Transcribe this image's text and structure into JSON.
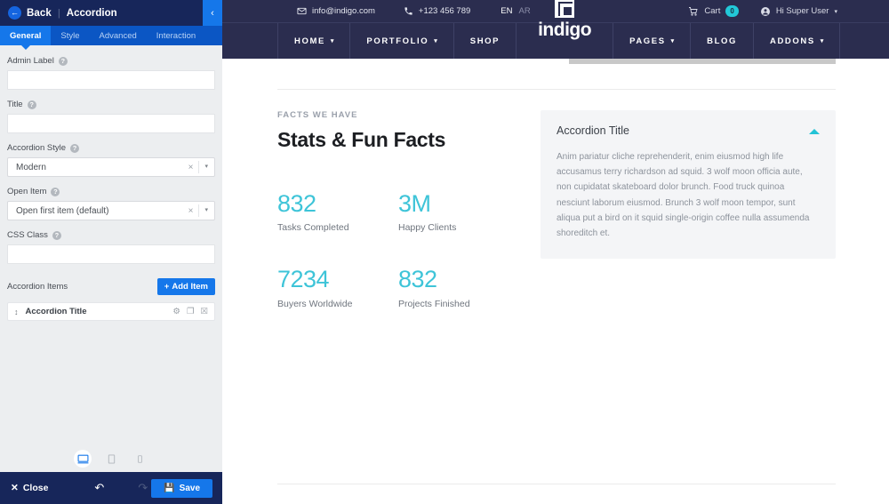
{
  "builder": {
    "header": {
      "back_icon": "arrow-left-icon",
      "back_label": "Back",
      "separator": "|",
      "title": "Accordion",
      "collapse_icon": "chevron-left-icon"
    },
    "tabs": [
      {
        "label": "General",
        "active": true
      },
      {
        "label": "Style",
        "active": false
      },
      {
        "label": "Advanced",
        "active": false
      },
      {
        "label": "Interaction",
        "active": false
      }
    ],
    "fields": {
      "admin_label": {
        "label": "Admin Label",
        "value": "",
        "placeholder": "",
        "help": "?"
      },
      "title": {
        "label": "Title",
        "value": "",
        "placeholder": "",
        "help": "?"
      },
      "accordion_style": {
        "label": "Accordion Style",
        "value": "Modern",
        "help": "?",
        "clear": "×",
        "arrow": "▾",
        "options": [
          "Modern"
        ]
      },
      "open_item": {
        "label": "Open Item",
        "value": "Open first item (default)",
        "help": "?",
        "clear": "×",
        "arrow": "▾",
        "options": [
          "Open first item (default)"
        ]
      },
      "css_class": {
        "label": "CSS Class",
        "value": "",
        "placeholder": "",
        "help": "?"
      }
    },
    "items_section": {
      "title": "Accordion Items",
      "add_label": "Add Item",
      "add_icon": "plus-icon",
      "items": [
        {
          "name": "Accordion Title",
          "drag_icon": "drag-handle-icon",
          "settings_icon": "gear-icon",
          "duplicate_icon": "copy-icon",
          "delete_icon": "trash-icon"
        }
      ]
    },
    "devices": [
      {
        "name": "desktop",
        "icon": "desktop-icon",
        "active": true
      },
      {
        "name": "tablet",
        "icon": "tablet-icon",
        "active": false
      },
      {
        "name": "mobile",
        "icon": "mobile-icon",
        "active": false
      }
    ],
    "footer": {
      "close_label": "Close",
      "close_icon": "close-icon",
      "undo_icon": "undo-icon",
      "redo_icon": "redo-icon",
      "save_label": "Save",
      "save_icon": "floppy-icon"
    },
    "colors": {
      "header_bg": "#17265a",
      "tab_bar": "#0b56c4",
      "accent": "#1577ea",
      "panel_bg": "#eceef0"
    }
  },
  "site": {
    "topbar": {
      "email_icon": "envelope-icon",
      "email": "info@indigo.com",
      "phone_icon": "phone-icon",
      "phone": "+123 456 789",
      "lang_active": "EN",
      "lang_inactive": "AR",
      "cart_icon": "cart-icon",
      "cart_label": "Cart",
      "cart_count": "0",
      "user_icon": "user-icon",
      "user_label": "Hi Super User",
      "user_caret": "⌄"
    },
    "logo": {
      "text": "indigo",
      "mark": "square-logo-icon"
    },
    "nav_left": [
      {
        "label": "HOME",
        "has_caret": true
      },
      {
        "label": "PORTFOLIO",
        "has_caret": true
      },
      {
        "label": "SHOP",
        "has_caret": false
      }
    ],
    "nav_right": [
      {
        "label": "PAGES",
        "has_caret": true
      },
      {
        "label": "BLOG",
        "has_caret": false
      },
      {
        "label": "ADDONS",
        "has_caret": true
      }
    ],
    "colors": {
      "header_bg": "#2b2d4f",
      "accent_teal": "#22c8d8",
      "stat_color": "#3ec4d8"
    }
  },
  "content": {
    "eyebrow": "FACTS WE HAVE",
    "title": "Stats & Fun Facts",
    "stats": [
      {
        "value": "832",
        "label": "Tasks Completed"
      },
      {
        "value": "3M",
        "label": "Happy Clients"
      },
      {
        "value": "7234",
        "label": "Buyers Worldwide"
      },
      {
        "value": "832",
        "label": "Projects Finished"
      }
    ],
    "accordion": {
      "title": "Accordion Title",
      "toggle_icon": "triangle-up-icon",
      "body": "Anim pariatur cliche reprehenderit, enim eiusmod high life accusamus terry richardson ad squid. 3 wolf moon officia aute, non cupidatat skateboard dolor brunch. Food truck quinoa nesciunt laborum eiusmod. Brunch 3 wolf moon tempor, sunt aliqua put a bird on it squid single-origin coffee nulla assumenda shoreditch et."
    }
  }
}
